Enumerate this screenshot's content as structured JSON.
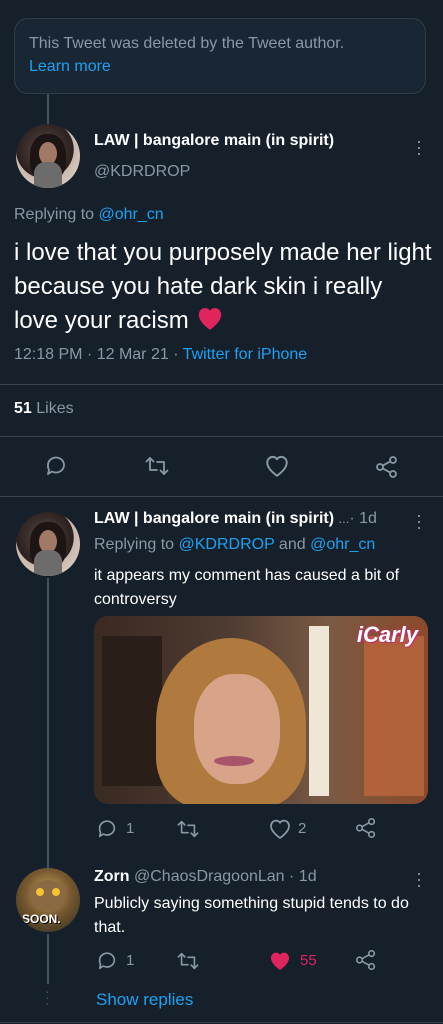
{
  "deleted_notice": {
    "text": "This Tweet was deleted by the Tweet author.",
    "learn_more": "Learn more"
  },
  "main_tweet": {
    "display_name": "LAW | bangalore main (in spirit)",
    "handle": "@KDRDROP",
    "replying_prefix": "Replying to",
    "replying_to": "@ohr_cn",
    "text": "i love that you purposely made her light because you hate dark skin i really love your racism",
    "time": "12:18 PM · 12 Mar 21 ·",
    "source": "Twitter for iPhone",
    "likes_count": "51",
    "likes_label": "Likes"
  },
  "reply1": {
    "display_name": "LAW | bangalore main (in spirit)",
    "ellipsis": "...",
    "age": "· 1d",
    "replying_prefix": "Replying to",
    "replying_to_1": "@KDRDROP",
    "and": "and",
    "replying_to_2": "@ohr_cn",
    "text": "it appears my comment has caused a bit of controversy",
    "image_watermark": "iCarly",
    "reply_count": "1",
    "like_count": "2"
  },
  "reply2": {
    "display_name": "Zorn",
    "handle": "@ChaosDragoonLan",
    "age": "· 1d",
    "text": "Publicly saying something stupid tends to do that.",
    "avatar_caption": "SOON.",
    "reply_count": "1",
    "like_count": "55"
  },
  "show_replies": "Show replies",
  "colors": {
    "background": "#15202b",
    "accent": "#1da1f2",
    "muted": "#8899a6",
    "like_red": "#e0245e"
  },
  "icons": [
    "reply-icon",
    "retweet-icon",
    "like-icon",
    "share-icon",
    "more-icon",
    "heart-emoji"
  ]
}
